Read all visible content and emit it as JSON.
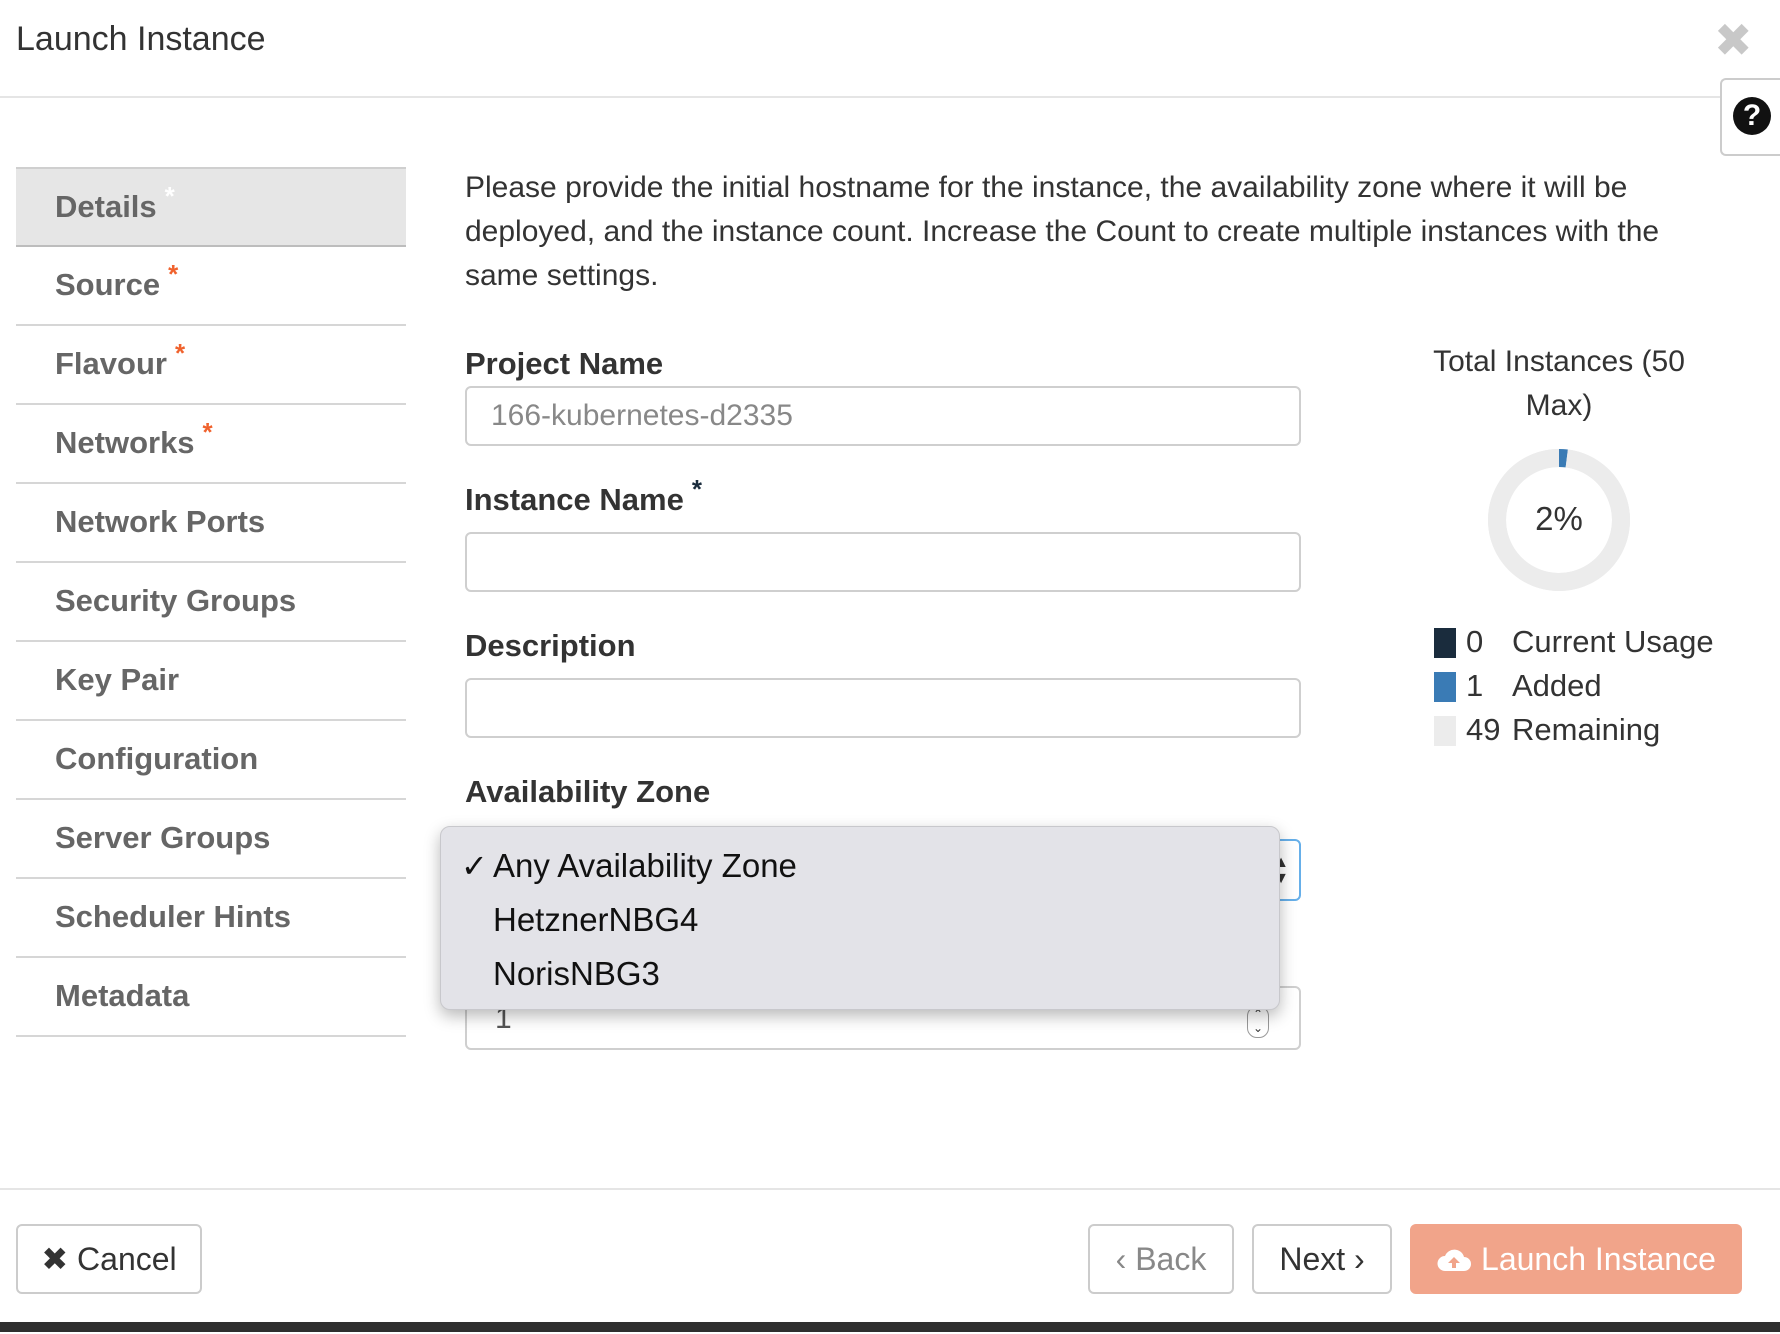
{
  "modal": {
    "title": "Launch Instance",
    "close_icon": "close-icon",
    "help_icon": "question-circle-icon",
    "help_glyph": "?"
  },
  "nav": {
    "items": [
      {
        "label": "Details",
        "required": true,
        "active": true
      },
      {
        "label": "Source",
        "required": true
      },
      {
        "label": "Flavour",
        "required": true
      },
      {
        "label": "Networks",
        "required": true
      },
      {
        "label": "Network Ports"
      },
      {
        "label": "Security Groups"
      },
      {
        "label": "Key Pair"
      },
      {
        "label": "Configuration"
      },
      {
        "label": "Server Groups"
      },
      {
        "label": "Scheduler Hints"
      },
      {
        "label": "Metadata"
      }
    ],
    "required_mark": "*"
  },
  "details": {
    "intro": "Please provide the initial hostname for the instance, the availability zone where it will be deployed, and the instance count. Increase the Count to create multiple instances with the same settings.",
    "project_name_label": "Project Name",
    "project_name_value": "166-kubernetes-d2335",
    "instance_name_label": "Instance Name",
    "instance_name_value": "",
    "description_label": "Description",
    "description_value": "",
    "availability_zone_label": "Availability Zone",
    "count_value": "1"
  },
  "dropdown": {
    "options": [
      "Any Availability Zone",
      "HetznerNBG4",
      "NorisNBG3"
    ],
    "selected": "Any Availability Zone",
    "check_glyph": "✓"
  },
  "chart_data": {
    "type": "pie",
    "title": "Total Instances (50 Max)",
    "center_label": "2%",
    "series": [
      {
        "name": "Current Usage",
        "value": 0,
        "color": "#1a2c3d"
      },
      {
        "name": "Added",
        "value": 1,
        "color": "#3a7bb5"
      },
      {
        "name": "Remaining",
        "value": 49,
        "color": "#ececec"
      }
    ]
  },
  "footer": {
    "cancel_label": "Cancel",
    "cancel_icon": "times-icon",
    "back_label": "Back",
    "next_label": "Next",
    "launch_label": "Launch Instance",
    "launch_icon": "cloud-upload-icon"
  },
  "colors": {
    "accent_required": "#f0622d",
    "launch_button": "#f1a48a",
    "focus_border": "#66afe9"
  }
}
